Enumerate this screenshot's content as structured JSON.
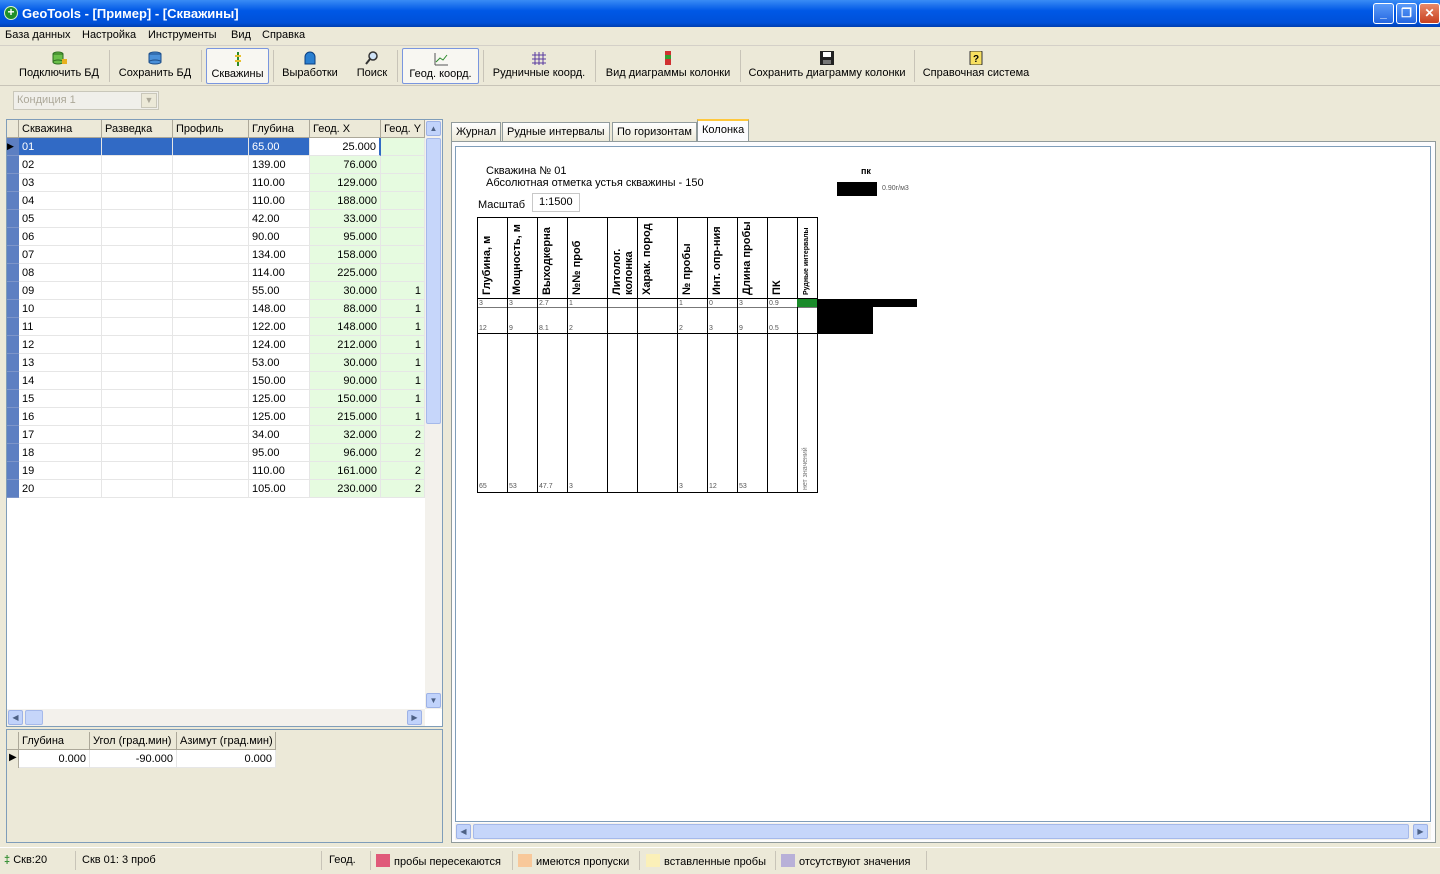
{
  "window": {
    "title": "GeoTools - [Пример] - [Скважины]"
  },
  "menu": [
    "База данных",
    "Настройка",
    "Инструменты",
    "Вид",
    "Справка"
  ],
  "toolbar": {
    "connect": "Подключить БД",
    "save_db": "Сохранить БД",
    "wells": "Скважины",
    "workings": "Выработки",
    "search": "Поиск",
    "geo_coords": "Геод. коорд.",
    "ore_coords": "Рудничные коорд.",
    "column_view": "Вид диаграммы колонки",
    "save_column": "Сохранить диаграмму колонки",
    "help": "Справочная система"
  },
  "condition": {
    "value": "Кондиция 1"
  },
  "wells_grid": {
    "headers": [
      "Скважина",
      "Разведка",
      "Профиль",
      "Глубина",
      "Геод. X",
      "Геод. Y"
    ],
    "rows": [
      [
        "01",
        "",
        "",
        "65.00",
        "25.000",
        ""
      ],
      [
        "02",
        "",
        "",
        "139.00",
        "76.000",
        ""
      ],
      [
        "03",
        "",
        "",
        "110.00",
        "129.000",
        ""
      ],
      [
        "04",
        "",
        "",
        "110.00",
        "188.000",
        ""
      ],
      [
        "05",
        "",
        "",
        "42.00",
        "33.000",
        ""
      ],
      [
        "06",
        "",
        "",
        "90.00",
        "95.000",
        ""
      ],
      [
        "07",
        "",
        "",
        "134.00",
        "158.000",
        ""
      ],
      [
        "08",
        "",
        "",
        "114.00",
        "225.000",
        ""
      ],
      [
        "09",
        "",
        "",
        "55.00",
        "30.000",
        "1"
      ],
      [
        "10",
        "",
        "",
        "148.00",
        "88.000",
        "1"
      ],
      [
        "11",
        "",
        "",
        "122.00",
        "148.000",
        "1"
      ],
      [
        "12",
        "",
        "",
        "124.00",
        "212.000",
        "1"
      ],
      [
        "13",
        "",
        "",
        "53.00",
        "30.000",
        "1"
      ],
      [
        "14",
        "",
        "",
        "150.00",
        "90.000",
        "1"
      ],
      [
        "15",
        "",
        "",
        "125.00",
        "150.000",
        "1"
      ],
      [
        "16",
        "",
        "",
        "125.00",
        "215.000",
        "1"
      ],
      [
        "17",
        "",
        "",
        "34.00",
        "32.000",
        "2"
      ],
      [
        "18",
        "",
        "",
        "95.00",
        "96.000",
        "2"
      ],
      [
        "19",
        "",
        "",
        "110.00",
        "161.000",
        "2"
      ],
      [
        "20",
        "",
        "",
        "105.00",
        "230.000",
        "2"
      ]
    ]
  },
  "incl_grid": {
    "headers": [
      "Глубина",
      "Угол (град.мин)",
      "Азимут (град.мин)"
    ],
    "rows": [
      [
        "0.000",
        "-90.000",
        "0.000"
      ]
    ]
  },
  "tabs": [
    "Журнал",
    "Рудные интервалы",
    "По горизонтам",
    "Колонка"
  ],
  "column": {
    "well_line": "Скважина № 01",
    "elevation_line": "Абсолютная отметка устья скважины - 150",
    "scale_label": "Масштаб",
    "scale_value": "1:1500",
    "legend_title": "пк",
    "legend_value": "0.90г/м3",
    "headers": [
      "Глубина, м",
      "Мощность, м",
      "Выходкерна",
      "№№ проб",
      "Литолог. колонка",
      "Харак. пород",
      "№ пробы",
      "Инт. опр-ния",
      "Длина пробы",
      "ПК",
      "Рудные интервалы"
    ],
    "row1": [
      "3",
      "3",
      "2.7",
      "1",
      "",
      "",
      "1",
      "0",
      "3",
      "0.9"
    ],
    "row2": [
      "12",
      "9",
      "8.1",
      "2",
      "",
      "",
      "2",
      "3",
      "9",
      "0.5"
    ],
    "row3": [
      "65",
      "53",
      "47.7",
      "3",
      "",
      "",
      "3",
      "12",
      "53",
      ""
    ],
    "no_values": "нет значений"
  },
  "status": {
    "wells_count": "Скв:20",
    "well_samples": "Скв 01: 3 проб",
    "mode": "Геод.",
    "legend": [
      {
        "label": "пробы пересекаются",
        "color": "#e05a7a"
      },
      {
        "label": "имеются пропуски",
        "color": "#f8c89a"
      },
      {
        "label": "вставленные пробы",
        "color": "#fbf0b8"
      },
      {
        "label": "отсутствуют значения",
        "color": "#b8b0d8"
      }
    ]
  }
}
